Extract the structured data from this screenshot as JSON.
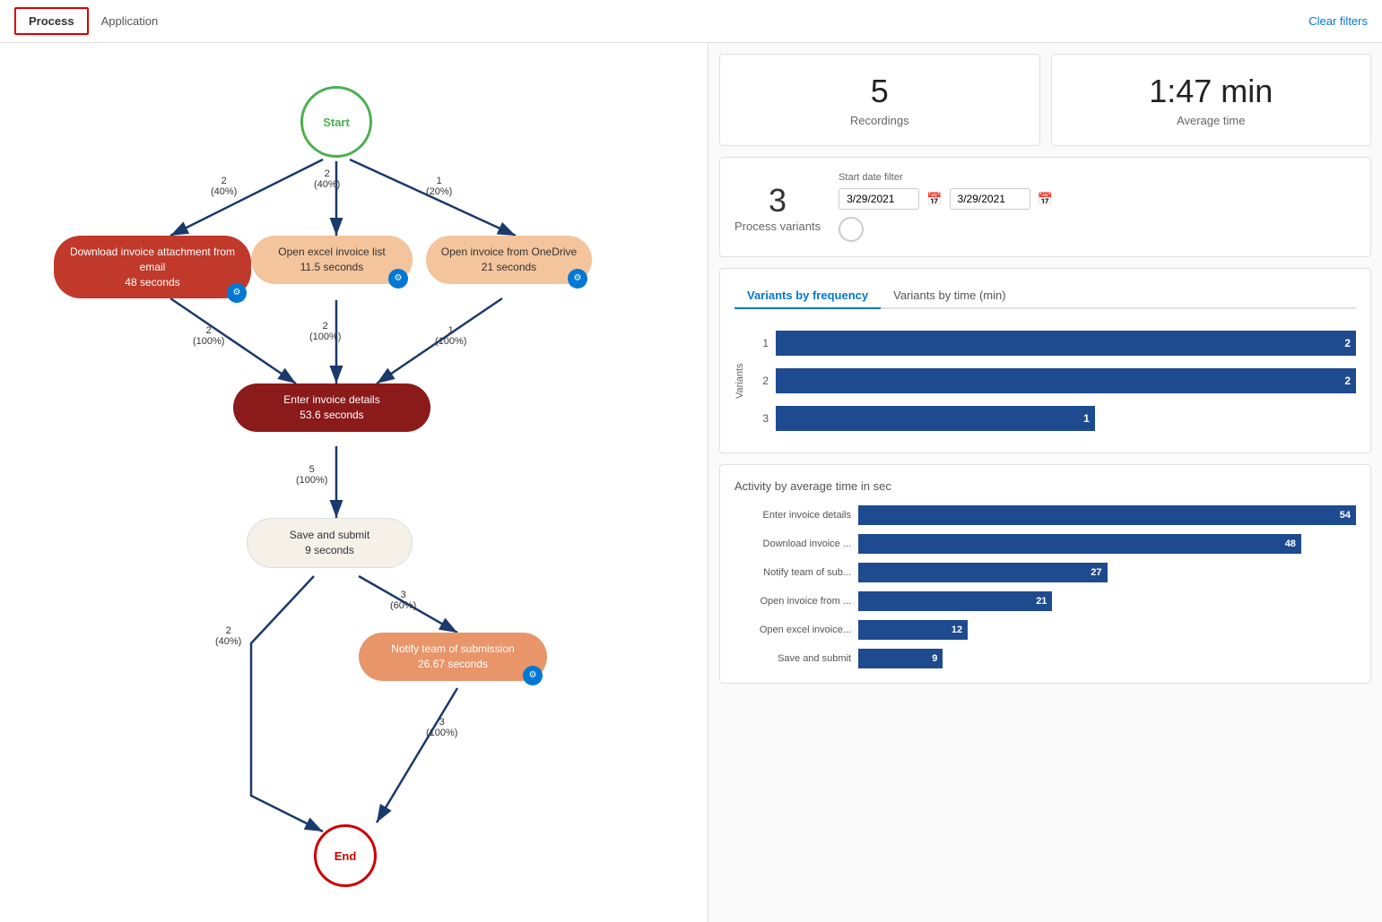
{
  "nav": {
    "tabs": [
      {
        "id": "process",
        "label": "Process",
        "active": true
      },
      {
        "id": "application",
        "label": "Application",
        "active": false
      }
    ],
    "clear_filters": "Clear filters"
  },
  "stats": {
    "recordings": {
      "value": "5",
      "label": "Recordings"
    },
    "avg_time": {
      "value": "1:47 min",
      "label": "Average time"
    },
    "process_variants": {
      "value": "3",
      "label": "Process variants"
    }
  },
  "date_filter": {
    "label": "Start date filter",
    "from": "3/29/2021",
    "to": "3/29/2021"
  },
  "variants_chart": {
    "tab_active": "Variants by frequency",
    "tab_inactive": "Variants by time (min)",
    "y_axis": "Variants",
    "bars": [
      {
        "label": "1",
        "value": 2,
        "max_pct": 100
      },
      {
        "label": "2",
        "value": 2,
        "max_pct": 100
      },
      {
        "label": "3",
        "value": 1,
        "max_pct": 55
      }
    ]
  },
  "activity_chart": {
    "title": "Activity by average time in sec",
    "bars": [
      {
        "name": "Enter invoice details",
        "value": 54,
        "max_pct": 100
      },
      {
        "name": "Download invoice ...",
        "value": 48,
        "max_pct": 89
      },
      {
        "name": "Notify team of sub...",
        "value": 27,
        "max_pct": 50
      },
      {
        "name": "Open invoice from ...",
        "value": 21,
        "max_pct": 39
      },
      {
        "name": "Open excel invoice...",
        "value": 12,
        "max_pct": 22
      },
      {
        "name": "Save and submit",
        "value": 9,
        "max_pct": 17
      }
    ]
  },
  "flow": {
    "start_label": "Start",
    "end_label": "End",
    "nodes": [
      {
        "id": "download",
        "label": "Download invoice attachment from email",
        "time": "48 seconds",
        "style": "red"
      },
      {
        "id": "excel",
        "label": "Open excel invoice list",
        "time": "11.5 seconds",
        "style": "peach"
      },
      {
        "id": "onedrive",
        "label": "Open invoice from OneDrive",
        "time": "21 seconds",
        "style": "peach"
      },
      {
        "id": "enter",
        "label": "Enter invoice details",
        "time": "53.6 seconds",
        "style": "dark-red"
      },
      {
        "id": "save",
        "label": "Save and submit",
        "time": "9 seconds",
        "style": "light"
      },
      {
        "id": "notify",
        "label": "Notify team of submission",
        "time": "26.67 seconds",
        "style": "orange"
      }
    ],
    "edges": [
      {
        "from": "start",
        "to": "download",
        "count": "2",
        "pct": "(40%)"
      },
      {
        "from": "start",
        "to": "excel",
        "count": "2",
        "pct": "(40%)"
      },
      {
        "from": "start",
        "to": "onedrive",
        "count": "1",
        "pct": "(20%)"
      },
      {
        "from": "download",
        "to": "enter",
        "count": "2",
        "pct": "(100%)"
      },
      {
        "from": "excel",
        "to": "enter",
        "count": "2",
        "pct": "(100%)"
      },
      {
        "from": "onedrive",
        "to": "enter",
        "count": "1",
        "pct": "(100%)"
      },
      {
        "from": "enter",
        "to": "save",
        "count": "5",
        "pct": "(100%)"
      },
      {
        "from": "save",
        "to": "notify",
        "count": "3",
        "pct": "(60%)"
      },
      {
        "from": "save",
        "to": "end",
        "count": "2",
        "pct": "(40%)"
      },
      {
        "from": "notify",
        "to": "end",
        "count": "3",
        "pct": "(100%)"
      }
    ]
  }
}
